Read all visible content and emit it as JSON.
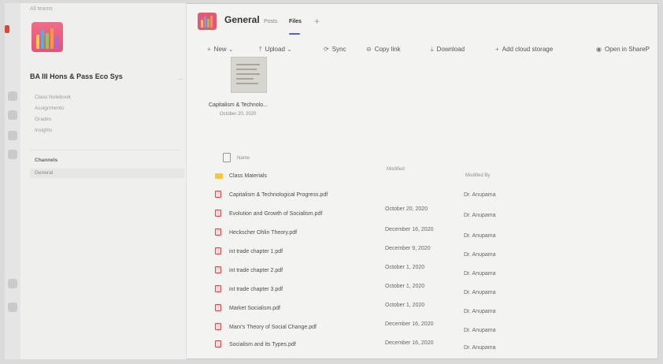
{
  "sidebar": {
    "back_link": "All teams",
    "team_name": "BA III Hons & Pass Eco Sys",
    "more": "...",
    "links": [
      "Class Notebook",
      "Assignments",
      "Grades",
      "Insights"
    ],
    "channels_header": "Channels",
    "channels": [
      "General"
    ]
  },
  "header": {
    "title": "General",
    "tabs": [
      {
        "label": "Posts",
        "active": false
      },
      {
        "label": "Files",
        "active": true
      }
    ],
    "add_tab": "+"
  },
  "toolbar": {
    "new": "New",
    "upload": "Upload",
    "sync": "Sync",
    "copy_link": "Copy link",
    "download": "Download",
    "add_cloud": "Add cloud storage",
    "open_sharepoint": "Open in ShareP"
  },
  "preview": {
    "name": "Capitalism & Technolo...",
    "date": "October 20, 2020"
  },
  "table": {
    "headers": {
      "name": "Name",
      "modified": "Modified",
      "modified_by": "Modified By"
    },
    "rows": [
      {
        "type": "folder",
        "name": "Class Materials",
        "modified": "",
        "by": ""
      },
      {
        "type": "pdf",
        "name": "Capitalism & Technological Progress.pdf",
        "modified": "",
        "by": "Dr. Anupama"
      },
      {
        "type": "pdf",
        "name": "Evolution and Growth of Socialism.pdf",
        "modified": "October 20, 2020",
        "by": "Dr. Anupama"
      },
      {
        "type": "pdf",
        "name": "Heckscher Ohlin Theory.pdf",
        "modified": "December 16, 2020",
        "by": "Dr. Anupama"
      },
      {
        "type": "pdf",
        "name": "int trade chapter 1.pdf",
        "modified": "December 9, 2020",
        "by": "Dr. Anupama"
      },
      {
        "type": "pdf",
        "name": "int trade chapter 2.pdf",
        "modified": "October 1, 2020",
        "by": "Dr. Anupama"
      },
      {
        "type": "pdf",
        "name": "int trade chapter 3.pdf",
        "modified": "October 1, 2020",
        "by": "Dr. Anupama"
      },
      {
        "type": "pdf",
        "name": "Market Socialism.pdf",
        "modified": "October 1, 2020",
        "by": "Dr. Anupama"
      },
      {
        "type": "pdf",
        "name": "Marx's Theory of Social Change.pdf",
        "modified": "December 16, 2020",
        "by": "Dr. Anupama"
      },
      {
        "type": "pdf",
        "name": "Socialism and its Types.pdf",
        "modified": "December 16, 2020",
        "by": "Dr. Anupama"
      }
    ]
  },
  "icons": [
    "folder-icon",
    "pdf-icon",
    "file-icon",
    "sync-icon",
    "link-icon",
    "download-icon",
    "upload-icon",
    "sharepoint-icon"
  ],
  "colors": {
    "accent": "#5b5fc7",
    "team_avatar": "#e5537b",
    "pdf_red": "#d14a4a",
    "folder": "#f4c44c"
  }
}
